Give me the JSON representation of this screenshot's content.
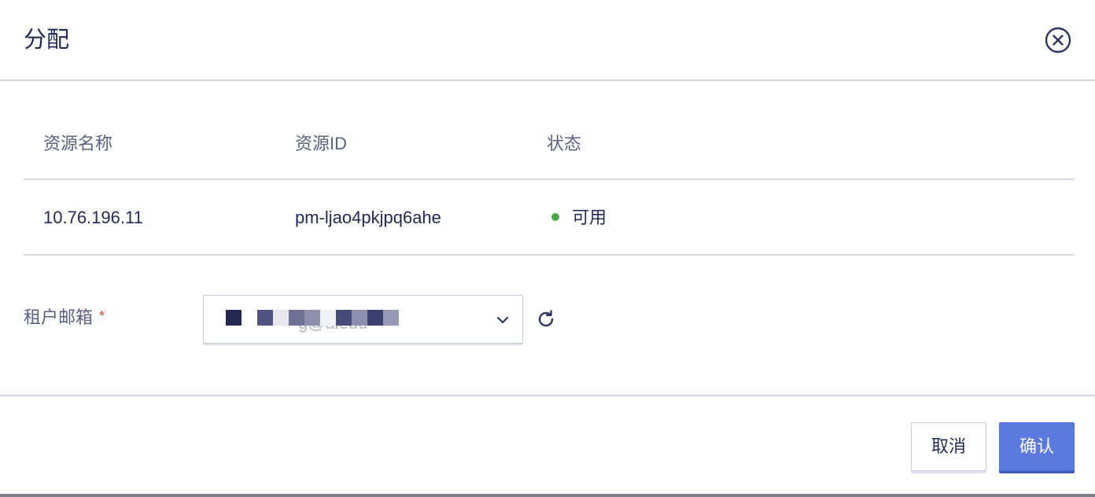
{
  "dialog": {
    "title": "分配",
    "close_icon": "circle-x-icon"
  },
  "table": {
    "headers": [
      "资源名称",
      "资源ID",
      "状态"
    ],
    "rows": [
      {
        "name": "10.76.196.11",
        "id": "pm-ljao4pkjpq6ahe",
        "status": "可用",
        "status_color": "#46a845"
      }
    ]
  },
  "form": {
    "email_label": "租户邮箱",
    "required_mark": "*",
    "email_value": "g@aiedu",
    "chevron_icon": "chevron-down-icon",
    "refresh_icon": "refresh-icon"
  },
  "footer": {
    "cancel_label": "取消",
    "confirm_label": "确认"
  },
  "colors": {
    "accent": "#5a7ae0",
    "text": "#232b55",
    "required": "#e0463f"
  }
}
